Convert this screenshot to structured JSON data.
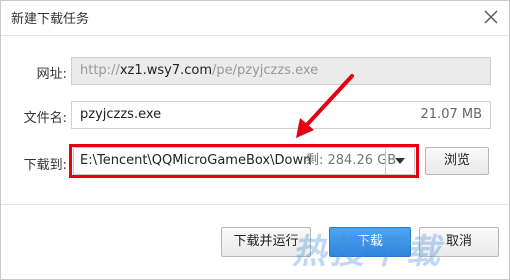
{
  "window": {
    "title": "新建下载任务"
  },
  "form": {
    "url_label": "网址:",
    "url_prefix": "http://",
    "url_domain": "xz1.wsy7.com",
    "url_path": "/pe/pzyjczzs.exe",
    "filename_label": "文件名:",
    "filename_value": "pzyjczzs.exe",
    "filesize": "21.07 MB",
    "dir_label": "下载到:",
    "dir_path": "E:\\Tencent\\QQMicroGameBox\\Downl",
    "dir_free": "剩: 284.26 GB",
    "browse_label": "浏览"
  },
  "buttons": {
    "run_label": "下载并运行",
    "download_label": "下载",
    "cancel_label": "取消"
  },
  "overlay": {
    "watermark_text": "热搜下载",
    "annotation_color": "#e60012"
  }
}
